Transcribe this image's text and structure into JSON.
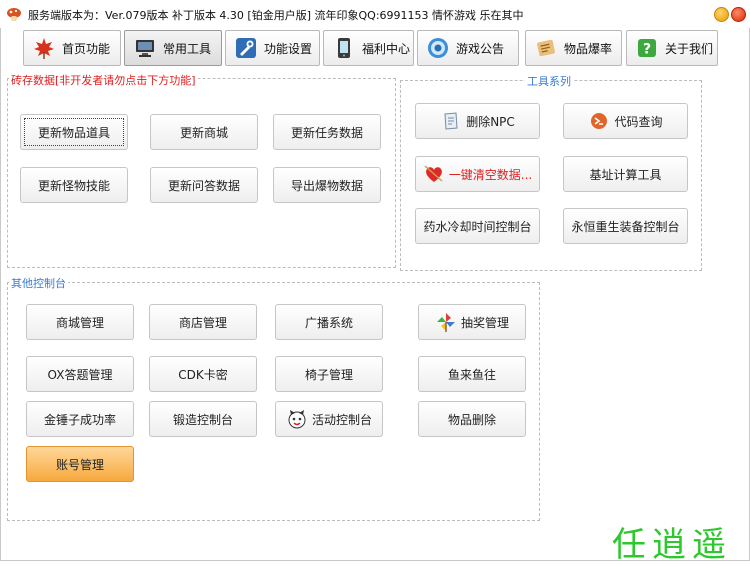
{
  "window": {
    "title": "服务端版本为：Ver.079版本 补丁版本 4.30 [铂金用户版] 流年印象QQ:6991153 情怀游戏 乐在其中"
  },
  "tabs": [
    {
      "label": "首页功能",
      "icon": "maple-leaf-icon"
    },
    {
      "label": "常用工具",
      "icon": "computer-icon"
    },
    {
      "label": "功能设置",
      "icon": "tools-icon"
    },
    {
      "label": "福利中心",
      "icon": "phone-icon"
    },
    {
      "label": "游戏公告",
      "icon": "speaker-icon"
    },
    {
      "label": "物品爆率",
      "icon": "scroll-icon"
    },
    {
      "label": "关于我们",
      "icon": "question-icon"
    }
  ],
  "active_tab": "常用工具",
  "cache_group": {
    "title": "砖存数据[非开发者请勿点击下方功能]",
    "title_color": "#e02020",
    "buttons": [
      "更新物品道具",
      "更新商城",
      "更新任务数据",
      "更新怪物技能",
      "更新问答数据",
      "导出爆物数据"
    ]
  },
  "tools_group": {
    "title": "工具系列",
    "title_color": "#3a7bd5",
    "buttons": [
      {
        "label": "删除NPC",
        "icon": "npc-icon"
      },
      {
        "label": "代码查询",
        "icon": "code-icon"
      },
      {
        "label": "一键清空数据...",
        "icon": "heart-icon"
      },
      {
        "label": "基址计算工具",
        "icon": ""
      },
      {
        "label": "药水冷却时间控制台",
        "icon": ""
      },
      {
        "label": "永恒重生装备控制台",
        "icon": ""
      }
    ]
  },
  "other_group": {
    "title": "其他控制台",
    "title_color": "#3a7bd5",
    "buttons": [
      {
        "label": "商城管理",
        "icon": ""
      },
      {
        "label": "商店管理",
        "icon": ""
      },
      {
        "label": "广播系统",
        "icon": ""
      },
      {
        "label": "抽奖管理",
        "icon": "pinwheel-icon"
      },
      {
        "label": "OX答题管理",
        "icon": ""
      },
      {
        "label": "CDK卡密",
        "icon": ""
      },
      {
        "label": "椅子管理",
        "icon": ""
      },
      {
        "label": "鱼来鱼往",
        "icon": ""
      },
      {
        "label": "金锤子成功率",
        "icon": ""
      },
      {
        "label": "锻造控制台",
        "icon": ""
      },
      {
        "label": "活动控制台",
        "icon": "cat-face-icon"
      },
      {
        "label": "物品删除",
        "icon": ""
      },
      {
        "label": "账号管理",
        "icon": ""
      }
    ]
  },
  "watermark": "任逍遥"
}
